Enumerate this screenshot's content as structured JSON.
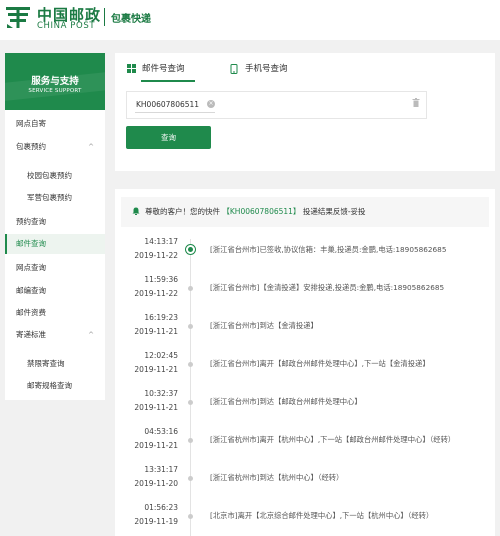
{
  "header": {
    "logo_cn": "中国邮政",
    "logo_en": "CHINA POST",
    "site_name": "包裹快递"
  },
  "sidebar": {
    "title": "服务与支持",
    "subtitle": "SERVICE SUPPORT",
    "items": [
      {
        "label": "网点自寄",
        "sub": false,
        "active": false,
        "chevron": ""
      },
      {
        "label": "包裹预约",
        "sub": false,
        "active": false,
        "chevron": "^"
      },
      {
        "label": "校园包裹预约",
        "sub": true,
        "active": false,
        "chevron": ""
      },
      {
        "label": "军营包裹预约",
        "sub": true,
        "active": false,
        "chevron": ""
      },
      {
        "label": "预约查询",
        "sub": false,
        "active": false,
        "chevron": ""
      },
      {
        "label": "邮件查询",
        "sub": false,
        "active": true,
        "chevron": ""
      },
      {
        "label": "网点查询",
        "sub": false,
        "active": false,
        "chevron": ""
      },
      {
        "label": "邮编查询",
        "sub": false,
        "active": false,
        "chevron": ""
      },
      {
        "label": "邮件资费",
        "sub": false,
        "active": false,
        "chevron": ""
      },
      {
        "label": "寄递标准",
        "sub": false,
        "active": false,
        "chevron": "^"
      },
      {
        "label": "禁限寄查询",
        "sub": true,
        "active": false,
        "chevron": ""
      },
      {
        "label": "邮寄规格查询",
        "sub": true,
        "active": false,
        "chevron": ""
      }
    ]
  },
  "query": {
    "tab_mail": "邮件号查询",
    "tab_phone": "手机号查询",
    "tracking_number": "KH00607806511",
    "button": "查询"
  },
  "results": {
    "greeting": "尊敬的客户！您的快件",
    "number_bracketed": "【KH00607806511】",
    "feedback": "投递结果反馈-妥投",
    "events": [
      {
        "time": "14:13:17",
        "date": "2019-11-22",
        "desc": "[浙江省台州市]已签收,协议信箱：丰巢,投递员:金鹏,电话:18905862685"
      },
      {
        "time": "11:59:36",
        "date": "2019-11-22",
        "desc": "[浙江省台州市]【金清投递】安排投递,投递员:金鹏,电话:18905862685"
      },
      {
        "time": "16:19:23",
        "date": "2019-11-21",
        "desc": "[浙江省台州市]到达【金清投递】"
      },
      {
        "time": "12:02:45",
        "date": "2019-11-21",
        "desc": "[浙江省台州市]离开【邮政台州邮件处理中心】,下一站【金清投递】"
      },
      {
        "time": "10:32:37",
        "date": "2019-11-21",
        "desc": "[浙江省台州市]到达【邮政台州邮件处理中心】"
      },
      {
        "time": "04:53:16",
        "date": "2019-11-21",
        "desc": "[浙江省杭州市]离开【杭州中心】,下一站【邮政台州邮件处理中心】（经转）"
      },
      {
        "time": "13:31:17",
        "date": "2019-11-20",
        "desc": "[浙江省杭州市]到达【杭州中心】（经转）"
      },
      {
        "time": "01:56:23",
        "date": "2019-11-19",
        "desc": "[北京市]离开【北京综合邮件处理中心】,下一站【杭州中心】（经转）"
      }
    ]
  },
  "colors": {
    "brand_green": "#1f8a4c",
    "background": "#f1f1f1"
  }
}
